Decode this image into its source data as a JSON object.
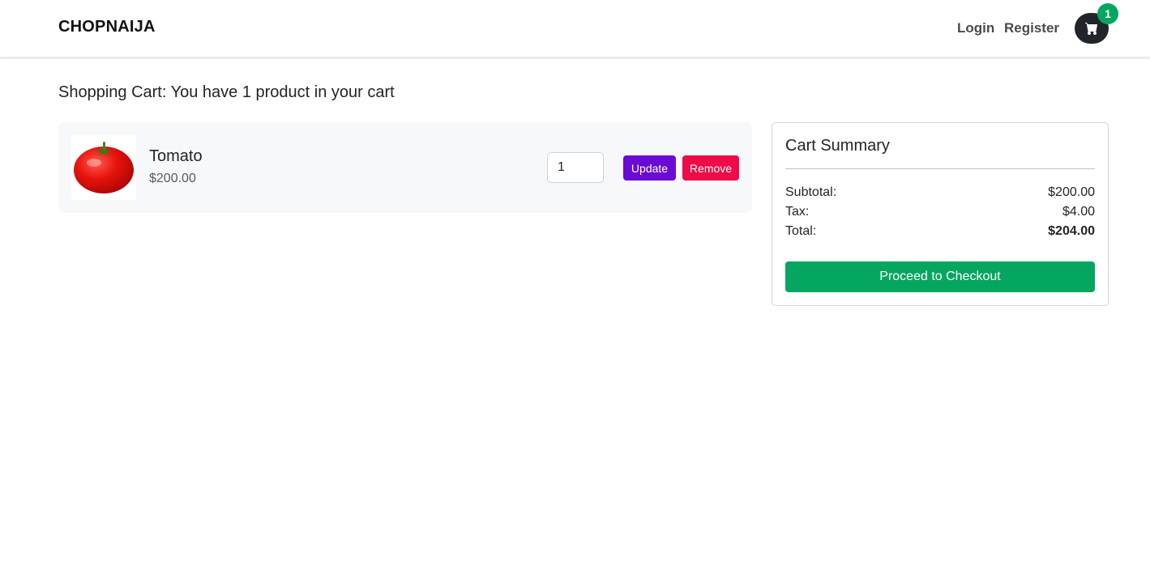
{
  "navbar": {
    "brand": "CHOPNAIJA",
    "links": {
      "login": "Login",
      "register": "Register"
    },
    "cart_icon": "shopping-cart-icon",
    "cart_count": "1"
  },
  "cart": {
    "heading": "Shopping Cart: You have 1 product in your cart",
    "items": [
      {
        "name": "Tomato",
        "price": "$200.00",
        "image_icon": "tomato-image",
        "quantity": "1",
        "update_label": "Update",
        "remove_label": "Remove"
      }
    ]
  },
  "summary": {
    "title": "Cart Summary",
    "subtotal_label": "Subtotal:",
    "subtotal_value": "$200.00",
    "tax_label": "Tax:",
    "tax_value": "$4.00",
    "total_label": "Total:",
    "total_value": "$204.00",
    "checkout_label": "Proceed to Checkout"
  },
  "colors": {
    "accent_green": "#05a660",
    "update_purple": "#6a0ad4",
    "remove_red": "#ee0b46",
    "cart_button_dark": "#212529"
  }
}
